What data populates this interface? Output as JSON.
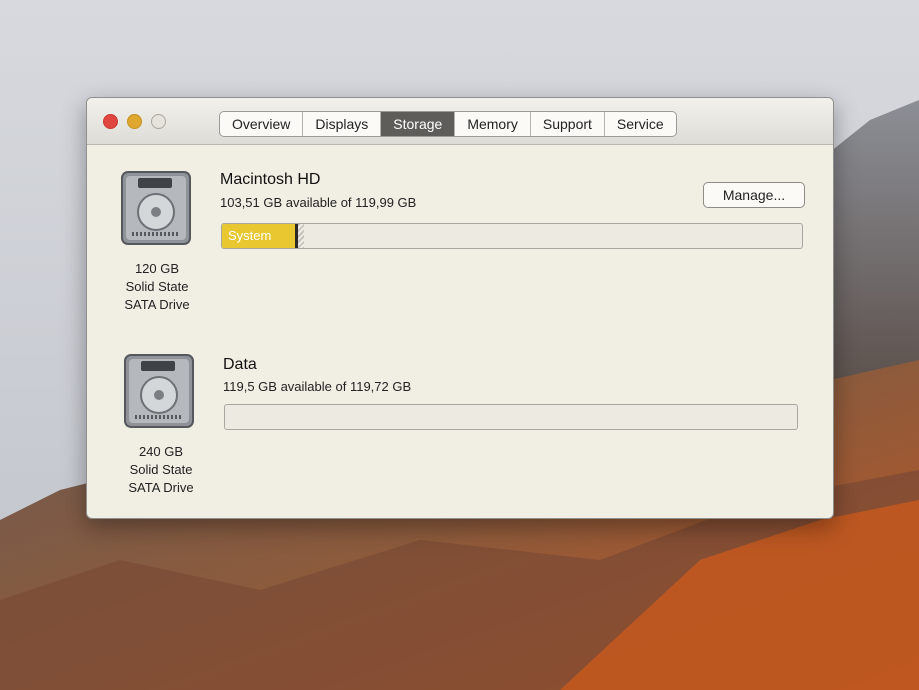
{
  "window": {
    "tabs": [
      "Overview",
      "Displays",
      "Storage",
      "Memory",
      "Support",
      "Service"
    ],
    "active_tab": "Storage"
  },
  "drives": [
    {
      "icon": "hard-drive-icon",
      "capacity": "120 GB",
      "type_line1": "Solid State",
      "type_line2": "SATA Drive",
      "volume_name": "Macintosh HD",
      "available_text": "103,51 GB available of 119,99 GB",
      "bar_segment_label": "System",
      "system_fraction": 0.125,
      "other_fraction": 0.01,
      "manage_label": "Manage..."
    },
    {
      "icon": "hard-drive-icon",
      "capacity": "240 GB",
      "type_line1": "Solid State",
      "type_line2": "SATA Drive",
      "volume_name": "Data",
      "available_text": "119,5 GB available of 119,72 GB",
      "system_fraction": 0.0
    }
  ],
  "colors": {
    "system_segment": "#e8c731",
    "active_tab_bg": "#5f5d5a",
    "close": "#e0463f",
    "minimize": "#dfa82c"
  }
}
